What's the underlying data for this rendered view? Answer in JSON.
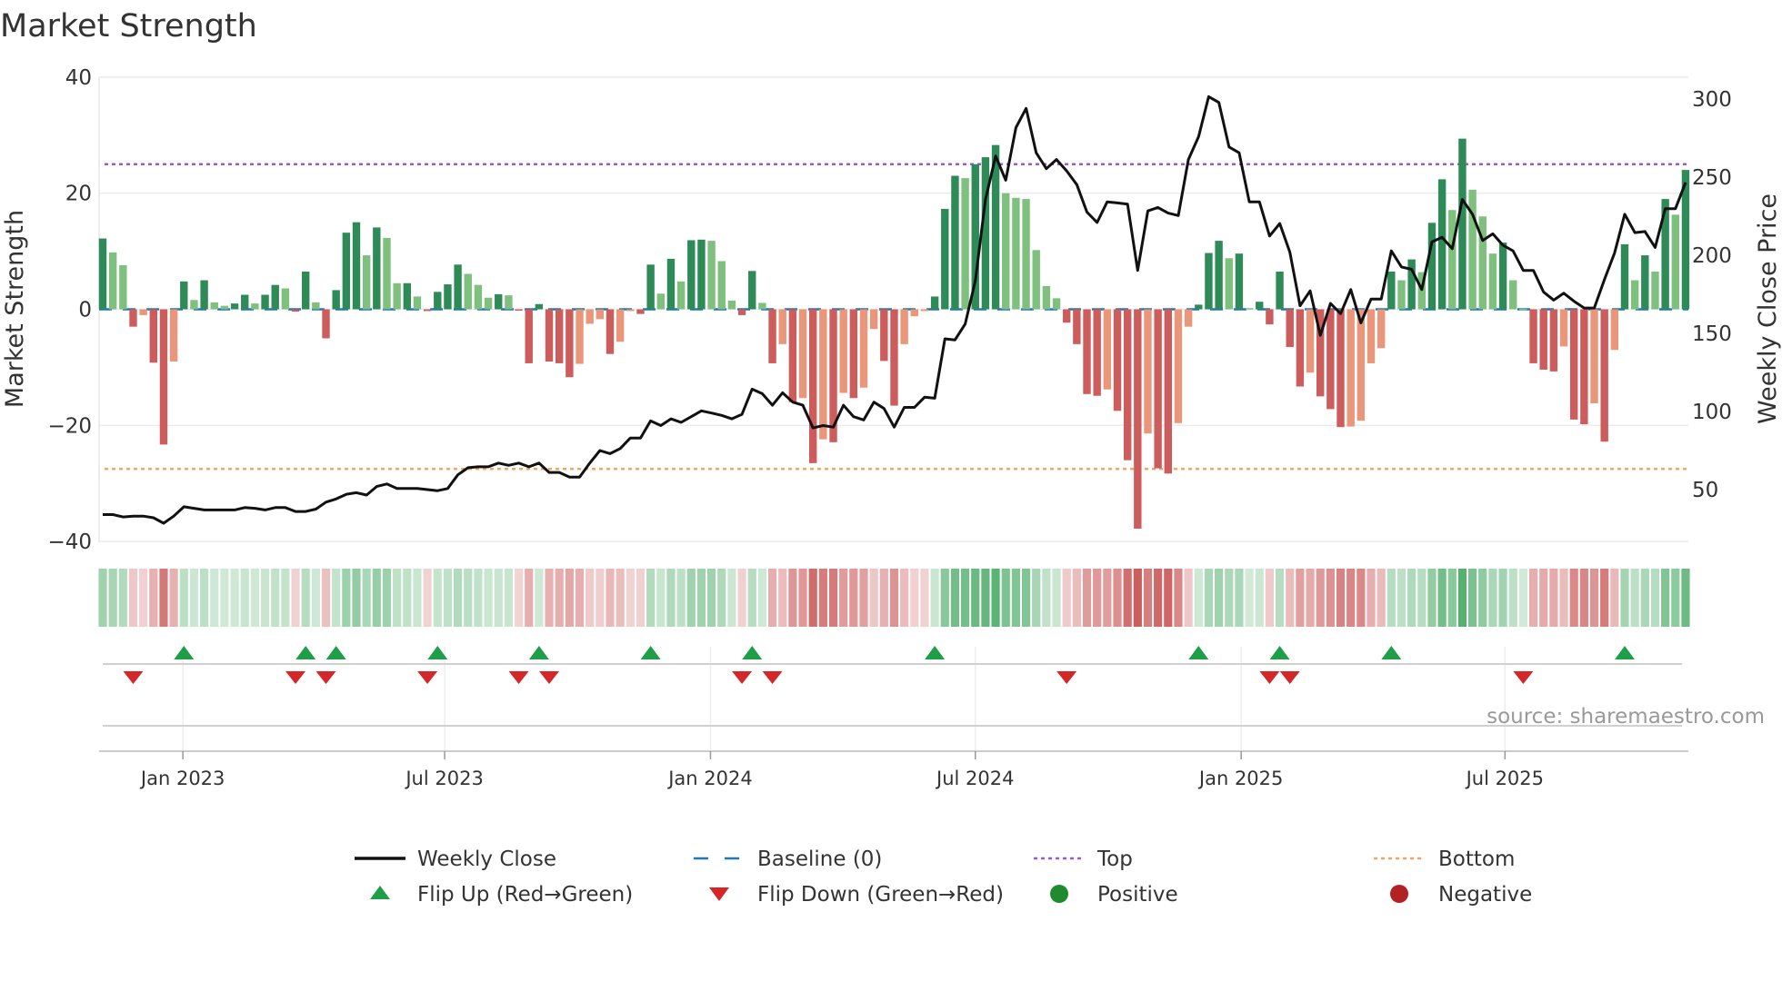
{
  "chart_data": {
    "type": "bar+line",
    "title": "Market Strength",
    "ylabel_left": "Market Strength",
    "ylabel_right": "Weekly Close Price",
    "source": "source: sharemaestro.com",
    "y_left": {
      "range": [
        -40,
        40
      ],
      "ticks": [
        "40",
        "20",
        "0",
        "−20",
        "−40"
      ],
      "tick_values": [
        40,
        20,
        0,
        -20,
        -40
      ]
    },
    "y_right": {
      "range": [
        0,
        300
      ],
      "ticks": [
        "300",
        "250",
        "200",
        "150",
        "100",
        "50"
      ],
      "tick_values": [
        300,
        250,
        200,
        150,
        100,
        50
      ]
    },
    "x_ticks": [
      "Jan 2023",
      "Jul 2023",
      "Jan 2024",
      "Jul 2024",
      "Jan 2025",
      "Jul 2025"
    ],
    "x_tick_week_index": [
      7.9,
      33.7,
      59.9,
      86.0,
      112.2,
      138.2
    ],
    "top_level": 25,
    "bottom_level": -27.5,
    "baseline": 0,
    "strength": [
      12.2,
      9.8,
      7.6,
      -3,
      -1,
      -9.2,
      -23.3,
      -9,
      4.8,
      1.6,
      5,
      1.2,
      0.6,
      1,
      2.5,
      1,
      2.5,
      4.2,
      3.6,
      -0.4,
      6.5,
      1.2,
      -5,
      3.3,
      13.2,
      15,
      9.3,
      14.1,
      12.3,
      4.5,
      4.5,
      2.2,
      -0.3,
      3,
      4.3,
      7.7,
      6.1,
      4.2,
      2,
      2.6,
      2.4,
      -0.2,
      -9.3,
      0.9,
      -9,
      -9.3,
      -11.7,
      -9.4,
      -2.5,
      -1.7,
      -7.7,
      -5.6,
      -0.3,
      -0.8,
      7.7,
      2.7,
      8.7,
      4.8,
      11.9,
      12,
      11.8,
      8.3,
      1.5,
      -1,
      6.6,
      1.1,
      -9.3,
      -6,
      -16,
      -15.3,
      -26.5,
      -22.4,
      -22.9,
      -14.4,
      -15.3,
      -13.5,
      -3.4,
      -8.9,
      -16.6,
      -6,
      -1.2,
      -0.3,
      2.2,
      17.3,
      23,
      22.6,
      25,
      26.2,
      28.3,
      20,
      19.2,
      19,
      10.2,
      4,
      1.9,
      -2.3,
      -6,
      -14.6,
      -14.9,
      -13.8,
      -17.5,
      -26,
      -37.8,
      -21.4,
      -27.4,
      -28.3,
      -19.6,
      -3,
      0.8,
      9.7,
      11.8,
      8.8,
      9.6,
      0.2,
      1.3,
      -2.6,
      6.5,
      -6.5,
      -13.3,
      -10.9,
      -15,
      -17.2,
      -20.3,
      -20.2,
      -19.2,
      -9.3,
      -6.7,
      6.5,
      5,
      8.6,
      6.4,
      14.9,
      22.4,
      17.1,
      29.4,
      20.6,
      16,
      9.6,
      11.5,
      5,
      0.1,
      -9.3,
      -10.4,
      -10.7,
      -6.4,
      -19,
      -19.8,
      -16.2,
      -22.8,
      -7,
      11.2,
      5,
      9.3,
      6.5,
      19,
      16.3,
      24
    ],
    "weekly_close": [
      34,
      34,
      32.5,
      33,
      33,
      32,
      28.5,
      33,
      39,
      38,
      37,
      37,
      37,
      37,
      38.5,
      38,
      37,
      38.5,
      38.5,
      36,
      36,
      37.5,
      42,
      44,
      47,
      48,
      46.5,
      52,
      53.6,
      50.7,
      50.7,
      50.7,
      50,
      49.3,
      50.7,
      59.5,
      64,
      64.6,
      64.6,
      67,
      65.5,
      67,
      64.6,
      67,
      61,
      61,
      58,
      58,
      67,
      75,
      73,
      76.3,
      83,
      83,
      94,
      91,
      95.3,
      93,
      96.7,
      100.4,
      99,
      97.5,
      95.3,
      98.2,
      114.3,
      111.4,
      104,
      112,
      106,
      104,
      89.5,
      91,
      90,
      104,
      96.7,
      94.6,
      106,
      101.9,
      90,
      102.6,
      102.6,
      109.2,
      108.5,
      146.5,
      145.8,
      156,
      183.8,
      235.7,
      263.5,
      248,
      281.7,
      294,
      265.6,
      255.4,
      261.3,
      254,
      245.2,
      227.6,
      221,
      234.2,
      233.5,
      232.7,
      190.3,
      228.4,
      230.6,
      227,
      225.4,
      261.3,
      275.9,
      301.5,
      297.8,
      269.3,
      265.6,
      234.2,
      234.2,
      212.3,
      220.3,
      202,
      167.7,
      177.2,
      148.7,
      169.2,
      162.6,
      178,
      156.7,
      172,
      172,
      202.8,
      192.5,
      191,
      178,
      208.6,
      211.5,
      204.2,
      235.7,
      226.2,
      209.4,
      213.7,
      206.4,
      202.8,
      190.3,
      190.3,
      176.5,
      171.3,
      175.7,
      170.6,
      166.2,
      166.2,
      184.5,
      201.4,
      226.2,
      214.5,
      215.2,
      205,
      229.8,
      229.8,
      246.6
    ],
    "flip_up_week_index": [
      8,
      20,
      23,
      33,
      43,
      54,
      64,
      82,
      108,
      116,
      127,
      150
    ],
    "flip_down_week_index": [
      3,
      19,
      22,
      32,
      41,
      44,
      63,
      66,
      95,
      115,
      117,
      140
    ],
    "colors": {
      "pos_strong": "#2e8b57",
      "pos_weak": "#80c07e",
      "neg_strong": "#cd5c5c",
      "neg_weak": "#e9967a",
      "line": "#111111",
      "baseline": "#1f77b4",
      "top": "#9b59d6",
      "bottom": "#f4a460",
      "flip_up": "#1e9e46",
      "flip_down": "#d62728",
      "positive": "#1e8c2e",
      "negative": "#b22222"
    },
    "legend": {
      "weekly_close": "Weekly Close",
      "baseline": "Baseline (0)",
      "top": "Top",
      "bottom": "Bottom",
      "flip_up": "Flip Up (Red→Green)",
      "flip_down": "Flip Down (Green→Red)",
      "positive": "Positive",
      "negative": "Negative"
    }
  }
}
